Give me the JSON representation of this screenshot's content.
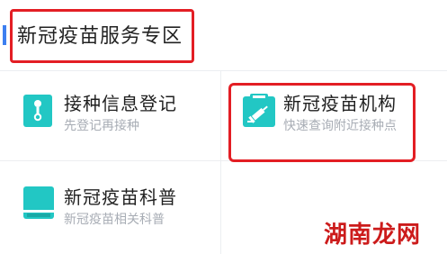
{
  "section": {
    "title": "新冠疫苗服务专区"
  },
  "cards": [
    {
      "title": "接种信息登记",
      "subtitle": "先登记再接种",
      "icon": "registration-tag-icon"
    },
    {
      "title": "新冠疫苗机构",
      "subtitle": "快速查询附近接种点",
      "icon": "vaccine-syringe-icon"
    },
    {
      "title": "新冠疫苗科普",
      "subtitle": "新冠疫苗相关科普",
      "icon": "book-icon"
    }
  ],
  "watermark": "湖南龙网",
  "colors": {
    "accent": "#3d7ff0",
    "icon": "#22c7c4",
    "highlight": "#e31e24"
  }
}
